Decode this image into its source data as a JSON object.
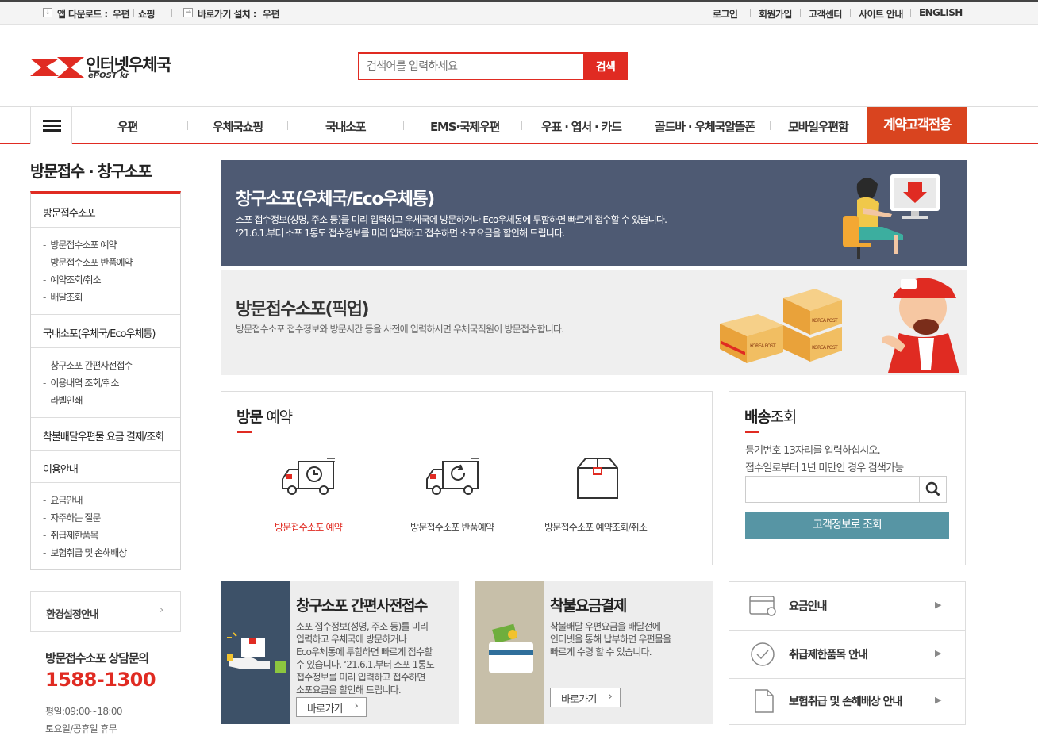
{
  "topbar": {
    "app_download_label": "앱 다운로드 :",
    "app_postal": "우편",
    "app_shopping": "쇼핑",
    "shortcut_label": "바로가기 설치 :",
    "shortcut_postal": "우편",
    "login": "로그인",
    "signup": "회원가입",
    "customer_center": "고객센터",
    "site_guide": "사이트 안내",
    "english": "ENGLISH"
  },
  "header": {
    "logo_text": "인터넷우체국",
    "logo_sub": "ePOST kr",
    "search_placeholder": "검색어를 입력하세요",
    "search_button": "검색"
  },
  "nav": {
    "items": [
      "우편",
      "우체국쇼핑",
      "국내소포",
      "EMS·국제우편",
      "우표 · 엽서 · 카드",
      "골드바 · 우체국알뜰폰",
      "모바일우편함"
    ],
    "contract": "계약고객전용"
  },
  "sidebar": {
    "title": "방문접수 · 창구소포",
    "section1": "방문접수소포",
    "section1_items": [
      "방문접수소포 예약",
      "방문접수소포 반품예약",
      "예약조회/취소",
      "배달조회"
    ],
    "section2": "국내소포(우체국/Eco우체통)",
    "section2_items": [
      "창구소포 간편사전접수",
      "이용내역 조회/취소",
      "라벨인쇄"
    ],
    "section3": "착불배달우편물 요금 결제/조회",
    "section4": "이용안내",
    "section4_items": [
      "요금안내",
      "자주하는 질문",
      "취급제한품목",
      "보험취급 및 손해배상"
    ],
    "env_guide": "환경설정안내",
    "consult_title": "방문접수소포 상담문의",
    "consult_phone": "1588-1300",
    "consult_hours": "평일:09:00~18:00",
    "consult_holiday": "토요일/공휴일 휴무"
  },
  "banner1": {
    "title": "창구소포(우체국/Eco우체통)",
    "desc1": "소포 접수정보(성명, 주소 등)를 미리 입력하고 우체국에 방문하거나 Eco우체통에 투함하면 빠르게 접수할 수 있습니다.",
    "desc2": "‘21.6.1.부터 소포 1통도 접수정보를 미리 입력하고 접수하면 소포요금을 할인해 드립니다."
  },
  "banner2": {
    "title": "방문접수소포(픽업)",
    "desc1": "방문접수소포 접수정보와 방문시간 등을 사전에 입력하시면 우체국직원이 방문접수합니다.",
    "box_label": "KOREA POST"
  },
  "visit": {
    "title_bold": "방문",
    "title_rest": " 예약",
    "items": [
      "방문접수소포 예약",
      "방문접수소포 반품예약",
      "방문접수소포 예약조회/취소"
    ]
  },
  "tracking": {
    "title_bold": "배송",
    "title_rest": "조회",
    "desc1": "등기번호 13자리를 입력하십시오.",
    "desc2": "접수일로부터 1년 미만인 경우 검색가능",
    "button": "고객정보로 조회"
  },
  "card1": {
    "title": "창구소포 간편사전접수",
    "lines": [
      "소포 접수정보(성명, 주소 등)를 미리",
      "입력하고 우체국에 방문하거나",
      "Eco우체통에 투함하면 빠르게 접수할",
      "수 있습니다. ‘21.6.1.부터 소포 1통도",
      "접수정보를 미리 입력하고 접수하면",
      "소포요금을 할인해 드립니다."
    ],
    "button": "바로가기"
  },
  "card2": {
    "title": "착불요금결제",
    "lines": [
      "착불배달 우편요금을 배달전에",
      "인터넷을 통해 납부하면 우편물을",
      "빠르게 수령 할 수 있습니다."
    ],
    "button": "바로가기"
  },
  "info": {
    "items": [
      "요금안내",
      "취급제한품목 안내",
      "보험취급 및 손해배상 안내"
    ]
  },
  "colors": {
    "brand_red": "#e02b22",
    "contract_orange": "#d9441f",
    "banner_navy": "#4e5a73",
    "teal_button": "#5795a4"
  }
}
